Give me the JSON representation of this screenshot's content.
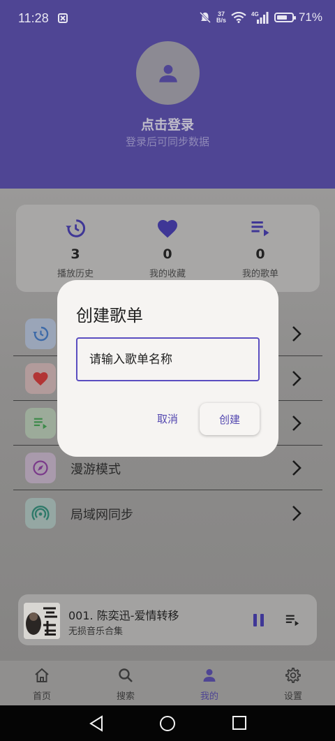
{
  "status_bar": {
    "time": "11:28",
    "net_speed_value": "37",
    "net_speed_unit": "B/s",
    "signal_label": "4G",
    "battery": "71%",
    "battery_level": 0.71
  },
  "profile": {
    "title": "点击登录",
    "subtitle": "登录后可同步数据"
  },
  "stats": [
    {
      "icon": "history-icon",
      "value": "3",
      "label": "播放历史"
    },
    {
      "icon": "heart-icon",
      "value": "0",
      "label": "我的收藏"
    },
    {
      "icon": "playlist-icon",
      "value": "0",
      "label": "我的歌单"
    }
  ],
  "menu": {
    "roam": "漫游模式",
    "lan_sync": "局域网同步"
  },
  "now_playing": {
    "title": "001. 陈奕迅-爱情转移",
    "album": "无损音乐合集"
  },
  "bottom_nav": [
    {
      "label": "首页",
      "icon": "home-icon"
    },
    {
      "label": "搜索",
      "icon": "search-icon"
    },
    {
      "label": "我的",
      "icon": "person-icon"
    },
    {
      "label": "设置",
      "icon": "gear-icon"
    }
  ],
  "dialog": {
    "title": "创建歌单",
    "input_placeholder": "请输入歌单名称",
    "input_value": "",
    "cancel_label": "取消",
    "create_label": "创建"
  },
  "colors": {
    "accent": "#5448b0",
    "header": "#4f4594",
    "dialog_bg": "#f6f4f2"
  }
}
